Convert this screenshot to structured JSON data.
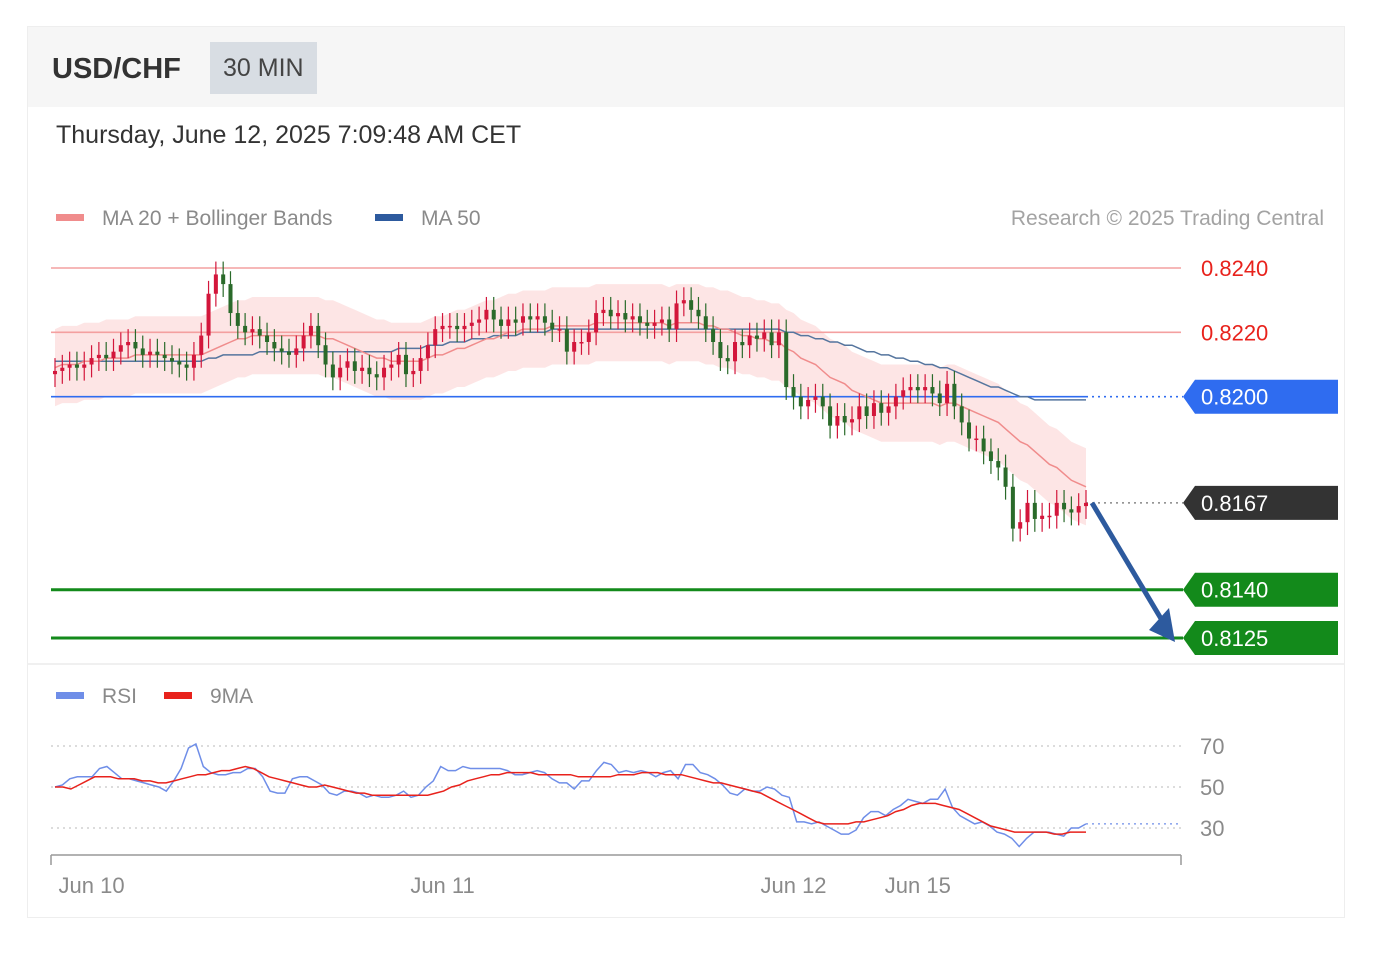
{
  "header": {
    "symbol": "USD/CHF",
    "timeframe": "30 MIN"
  },
  "datetime": "Thursday, June 12, 2025 7:09:48 AM CET",
  "legend": {
    "ma20_bb": "MA 20 + Bollinger Bands",
    "ma50": "MA 50",
    "rsi": "RSI",
    "rsi_ma": "9MA"
  },
  "copyright": "Research © 2025 Trading Central",
  "colors": {
    "ma20": "#f08c8c",
    "bands": "#fde0e0",
    "ma50": "#55759e",
    "pivot_line": "#2f6cf0",
    "support_line": "#138a1b",
    "resistance_label": "#e8221c",
    "candle_up": "#d3163b",
    "candle_down": "#2a6a2a",
    "rsi": "#6f8ee8",
    "rsi_ma": "#e8221c",
    "arrow": "#2d5a9e",
    "current_tag": "#333333"
  },
  "chart_data": {
    "type": "candlestick",
    "symbol": "USD/CHF",
    "ylim": [
      0.8121,
      0.8244
    ],
    "levels": [
      {
        "value": 0.824,
        "label": "0.8240",
        "kind": "resistance"
      },
      {
        "value": 0.822,
        "label": "0.8220",
        "kind": "resistance"
      },
      {
        "value": 0.82,
        "label": "0.8200",
        "kind": "pivot"
      },
      {
        "value": 0.8167,
        "label": "0.8167",
        "kind": "current"
      },
      {
        "value": 0.814,
        "label": "0.8140",
        "kind": "support"
      },
      {
        "value": 0.8125,
        "label": "0.8125",
        "kind": "support"
      }
    ],
    "x_ticks": [
      {
        "index": 5,
        "label": "Jun 10"
      },
      {
        "index": 53,
        "label": "Jun 11"
      },
      {
        "index": 101,
        "label": "Jun 12"
      },
      {
        "index": 118,
        "label": "Jun 15"
      }
    ],
    "closes": [
      0.8208,
      0.8209,
      0.821,
      0.8209,
      0.821,
      0.8212,
      0.8213,
      0.8212,
      0.8214,
      0.8216,
      0.8217,
      0.8215,
      0.8213,
      0.8214,
      0.8213,
      0.8212,
      0.8211,
      0.821,
      0.8209,
      0.8213,
      0.8219,
      0.8232,
      0.8238,
      0.8235,
      0.8226,
      0.8222,
      0.822,
      0.8221,
      0.8219,
      0.8217,
      0.8215,
      0.8214,
      0.8213,
      0.8215,
      0.8219,
      0.8222,
      0.8216,
      0.821,
      0.8206,
      0.8209,
      0.8211,
      0.8208,
      0.8209,
      0.8207,
      0.8206,
      0.8209,
      0.821,
      0.8213,
      0.8207,
      0.8208,
      0.8212,
      0.8216,
      0.8221,
      0.8222,
      0.8222,
      0.8221,
      0.8222,
      0.8223,
      0.8224,
      0.8227,
      0.8224,
      0.8222,
      0.8224,
      0.8223,
      0.8225,
      0.8224,
      0.8225,
      0.8223,
      0.8221,
      0.8221,
      0.8214,
      0.8217,
      0.8217,
      0.822,
      0.8226,
      0.8227,
      0.8225,
      0.8226,
      0.8224,
      0.8225,
      0.8223,
      0.8222,
      0.8223,
      0.8224,
      0.8221,
      0.8229,
      0.823,
      0.8227,
      0.8225,
      0.8221,
      0.8217,
      0.8212,
      0.8211,
      0.8217,
      0.8216,
      0.8219,
      0.8218,
      0.822,
      0.8216,
      0.822,
      0.8203,
      0.82,
      0.8197,
      0.8199,
      0.82,
      0.8197,
      0.8191,
      0.8194,
      0.8192,
      0.8193,
      0.8197,
      0.8194,
      0.8198,
      0.8195,
      0.8197,
      0.82,
      0.8202,
      0.8203,
      0.8202,
      0.8203,
      0.8201,
      0.8198,
      0.8204,
      0.8197,
      0.8192,
      0.8187,
      0.8187,
      0.8183,
      0.818,
      0.8178,
      0.8172,
      0.8159,
      0.8161,
      0.8167,
      0.8162,
      0.8163,
      0.8163,
      0.8167,
      0.8165,
      0.8164,
      0.8166,
      0.8167
    ],
    "ma20": [
      0.8209,
      0.821,
      0.821,
      0.821,
      0.8211,
      0.8211,
      0.8211,
      0.8212,
      0.8212,
      0.8212,
      0.8212,
      0.8213,
      0.8213,
      0.8213,
      0.8213,
      0.8213,
      0.8213,
      0.8213,
      0.8213,
      0.8213,
      0.8213,
      0.8214,
      0.8215,
      0.8216,
      0.8217,
      0.8218,
      0.8218,
      0.8219,
      0.8219,
      0.8219,
      0.8219,
      0.8219,
      0.8219,
      0.8219,
      0.8219,
      0.8219,
      0.8219,
      0.8218,
      0.8218,
      0.8217,
      0.8216,
      0.8215,
      0.8214,
      0.8213,
      0.8212,
      0.8212,
      0.8211,
      0.8211,
      0.8211,
      0.8211,
      0.8211,
      0.8212,
      0.8213,
      0.8213,
      0.8214,
      0.8215,
      0.8215,
      0.8216,
      0.8217,
      0.8218,
      0.8218,
      0.8219,
      0.822,
      0.822,
      0.8221,
      0.8221,
      0.8221,
      0.8221,
      0.8222,
      0.8222,
      0.8222,
      0.8222,
      0.8222,
      0.8222,
      0.8223,
      0.8223,
      0.8223,
      0.8223,
      0.8223,
      0.8223,
      0.8223,
      0.8223,
      0.8223,
      0.8223,
      0.8222,
      0.8223,
      0.8223,
      0.8223,
      0.8223,
      0.8222,
      0.8222,
      0.8221,
      0.8221,
      0.822,
      0.8219,
      0.8219,
      0.8218,
      0.8218,
      0.8217,
      0.8217,
      0.8215,
      0.8214,
      0.8212,
      0.8211,
      0.821,
      0.8208,
      0.8206,
      0.8205,
      0.8204,
      0.8202,
      0.8201,
      0.82,
      0.8199,
      0.8198,
      0.8198,
      0.8198,
      0.8198,
      0.8198,
      0.8198,
      0.8198,
      0.8198,
      0.8197,
      0.8198,
      0.8198,
      0.8197,
      0.8196,
      0.8195,
      0.8194,
      0.8193,
      0.8192,
      0.819,
      0.8188,
      0.8186,
      0.8185,
      0.8183,
      0.8181,
      0.8179,
      0.8178,
      0.8176,
      0.8174,
      0.8173,
      0.8172
    ],
    "ma50": [
      0.8211,
      0.8211,
      0.8211,
      0.8211,
      0.8211,
      0.8211,
      0.8211,
      0.8211,
      0.8211,
      0.8211,
      0.8211,
      0.8211,
      0.8211,
      0.8211,
      0.8211,
      0.8211,
      0.8211,
      0.8211,
      0.8211,
      0.8211,
      0.8211,
      0.8212,
      0.8212,
      0.8213,
      0.8213,
      0.8213,
      0.8213,
      0.8213,
      0.8214,
      0.8214,
      0.8214,
      0.8214,
      0.8214,
      0.8214,
      0.8214,
      0.8214,
      0.8214,
      0.8214,
      0.8214,
      0.8214,
      0.8214,
      0.8214,
      0.8214,
      0.8214,
      0.8214,
      0.8214,
      0.8214,
      0.8215,
      0.8215,
      0.8215,
      0.8215,
      0.8216,
      0.8216,
      0.8216,
      0.8217,
      0.8217,
      0.8217,
      0.8218,
      0.8218,
      0.8218,
      0.8219,
      0.8219,
      0.8219,
      0.8219,
      0.822,
      0.822,
      0.822,
      0.822,
      0.8221,
      0.8221,
      0.8221,
      0.8221,
      0.8221,
      0.8221,
      0.8221,
      0.8221,
      0.8221,
      0.8221,
      0.8221,
      0.8221,
      0.8221,
      0.8221,
      0.8221,
      0.8221,
      0.8221,
      0.8221,
      0.8221,
      0.8221,
      0.8221,
      0.8221,
      0.8221,
      0.8221,
      0.8221,
      0.8221,
      0.8221,
      0.8221,
      0.8221,
      0.8221,
      0.8221,
      0.8221,
      0.822,
      0.822,
      0.8219,
      0.8219,
      0.8218,
      0.8218,
      0.8217,
      0.8217,
      0.8216,
      0.8216,
      0.8215,
      0.8214,
      0.8214,
      0.8213,
      0.8213,
      0.8212,
      0.8212,
      0.8211,
      0.8211,
      0.821,
      0.821,
      0.8209,
      0.8209,
      0.8208,
      0.8207,
      0.8206,
      0.8205,
      0.8204,
      0.8203,
      0.8203,
      0.8202,
      0.8201,
      0.82,
      0.82,
      0.8199,
      0.8199,
      0.8199,
      0.8199,
      0.8199,
      0.8199,
      0.8199,
      0.8199
    ],
    "bb_width": 0.0012,
    "forecast_target": 0.8125,
    "rsi": {
      "ylim": [
        18,
        82
      ],
      "levels": [
        {
          "value": 70,
          "label": "70"
        },
        {
          "value": 50,
          "label": "50"
        },
        {
          "value": 30,
          "label": "30"
        }
      ],
      "series": [
        50,
        51,
        54,
        55,
        55,
        55,
        59,
        60,
        57,
        54,
        54,
        53,
        52,
        51,
        50,
        48,
        53,
        59,
        69,
        71,
        60,
        57,
        56,
        56,
        57,
        57,
        59,
        59,
        55,
        48,
        47,
        47,
        54,
        55,
        55,
        53,
        51,
        47,
        46,
        48,
        48,
        47,
        45,
        46,
        45,
        45,
        46,
        48,
        45,
        46,
        50,
        53,
        60,
        58,
        58,
        60,
        59,
        59,
        59,
        59,
        59,
        58,
        56,
        56,
        57,
        58,
        57,
        54,
        52,
        52,
        49,
        53,
        53,
        58,
        62,
        61,
        57,
        58,
        57,
        58,
        57,
        55,
        57,
        58,
        54,
        61,
        61,
        57,
        56,
        54,
        51,
        47,
        46,
        49,
        48,
        48,
        50,
        49,
        46,
        45,
        33,
        33,
        32,
        33,
        31,
        29,
        27,
        27,
        29,
        35,
        38,
        38,
        36,
        39,
        41,
        44,
        43,
        42,
        44,
        44,
        49,
        40,
        36,
        34,
        32,
        33,
        31,
        28,
        27,
        25,
        21,
        25,
        28,
        28,
        28,
        27,
        26,
        30,
        30,
        32
      ],
      "ma9": [
        50,
        50,
        49,
        51,
        53,
        55,
        55,
        55,
        54,
        54,
        54,
        53,
        53,
        52,
        52,
        53,
        54,
        55,
        56,
        56,
        57,
        58,
        58,
        59,
        60,
        59,
        57,
        55,
        54,
        53,
        52,
        51,
        50,
        50,
        51,
        50,
        49,
        48,
        47,
        47,
        46,
        46,
        46,
        46,
        46,
        46,
        46,
        46,
        47,
        48,
        50,
        51,
        53,
        54,
        55,
        56,
        56,
        57,
        57,
        57,
        57,
        56,
        56,
        56,
        56,
        56,
        55,
        55,
        55,
        55,
        55,
        56,
        56,
        56,
        57,
        57,
        57,
        56,
        56,
        56,
        55,
        54,
        53,
        52,
        52,
        51,
        50,
        49,
        48,
        47,
        45,
        43,
        41,
        39,
        37,
        35,
        33,
        32,
        32,
        32,
        32,
        33,
        33,
        34,
        35,
        36,
        38,
        39,
        41,
        42,
        42,
        42,
        41,
        40,
        39,
        37,
        35,
        33,
        31,
        30,
        29,
        28,
        28,
        28,
        28,
        28,
        27,
        27,
        28,
        28,
        28
      ]
    }
  }
}
